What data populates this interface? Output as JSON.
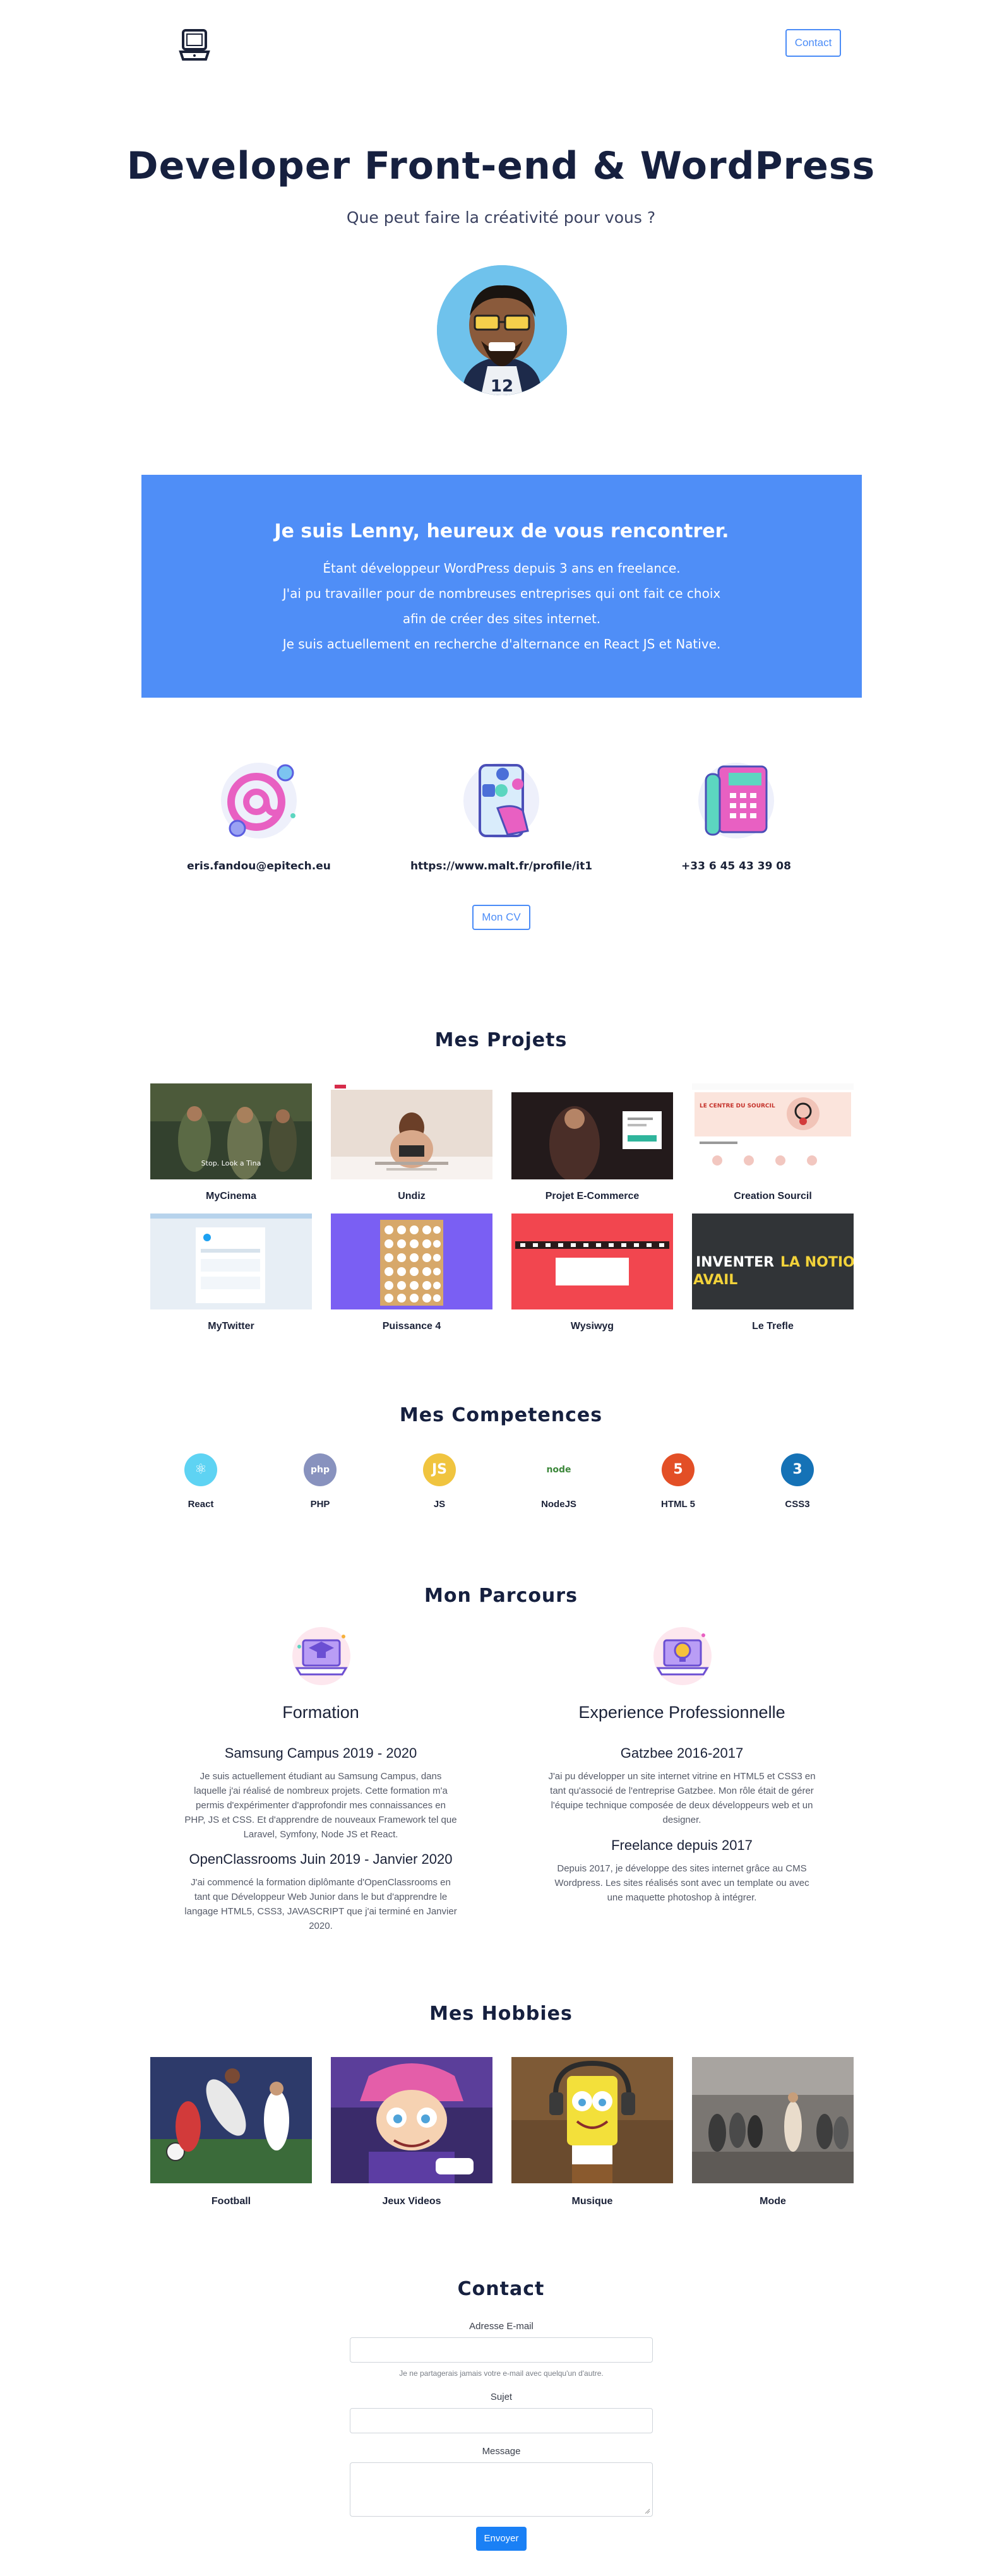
{
  "header": {
    "contact_label": "Contact"
  },
  "hero": {
    "title": "Developer Front-end & WordPress",
    "subtitle": "Que peut faire la créativité pour vous ?"
  },
  "intro": {
    "title": "Je suis Lenny, heureux de vous rencontrer.",
    "lines": [
      "Étant développeur WordPress depuis 3 ans en freelance.",
      "J'ai pu travailler pour de nombreuses entreprises qui ont fait ce choix",
      "afin de créer des sites internet.",
      "Je suis actuellement en recherche d'alternance en React JS et Native."
    ]
  },
  "contact_info": {
    "items": [
      {
        "icon": "email-at-icon",
        "text": "eris.fandou@epitech.eu"
      },
      {
        "icon": "social-phone-icon",
        "text": "https://www.malt.fr/profile/it1"
      },
      {
        "icon": "telephone-icon",
        "text": "+33 6 45 43 39 08"
      }
    ],
    "cv_label": "Mon CV"
  },
  "projects": {
    "title": "Mes Projets",
    "items": [
      {
        "name": "MyCinema"
      },
      {
        "name": "Undiz"
      },
      {
        "name": "Projet E-Commerce"
      },
      {
        "name": "Creation Sourcil"
      },
      {
        "name": "MyTwitter"
      },
      {
        "name": "Puissance 4"
      },
      {
        "name": "Wysiwyg"
      },
      {
        "name": "Le Trefle"
      }
    ],
    "thumb_texts": {
      "mycinema": "Stop. Look a Tina",
      "trefle_1": "INVENTER",
      "trefle_2": "LA NOTION DE",
      "trefle_3": "AVAIL",
      "sourcil": "LE CENTRE DU SOURCIL"
    }
  },
  "skills": {
    "title": "Mes Competences",
    "items": [
      {
        "name": "React",
        "icon": "react-icon",
        "glyph": "⚛",
        "color": "#5ed3f3"
      },
      {
        "name": "PHP",
        "icon": "php-icon",
        "glyph": "php",
        "color": "#8892be"
      },
      {
        "name": "JS",
        "icon": "js-icon",
        "glyph": "JS",
        "color": "#f0c43f"
      },
      {
        "name": "NodeJS",
        "icon": "nodejs-icon",
        "glyph": "node",
        "color": "#ffffff"
      },
      {
        "name": "HTML 5",
        "icon": "html5-icon",
        "glyph": "5",
        "color": "#e34f26"
      },
      {
        "name": "CSS3",
        "icon": "css3-icon",
        "glyph": "3",
        "color": "#1572b6"
      }
    ]
  },
  "parcours": {
    "title": "Mon Parcours",
    "formation": {
      "heading": "Formation",
      "entries": [
        {
          "title": "Samsung Campus 2019 - 2020",
          "lines": [
            "Je suis actuellement étudiant au Samsung Campus, dans",
            "laquelle j'ai réalisé de nombreux projets. Cette formation m'a",
            "permis d'expérimenter d'approfondir mes connaissances en",
            "PHP, JS et CSS. Et d'apprendre de nouveaux Framework tel que",
            "Laravel, Symfony, Node JS et React."
          ]
        },
        {
          "title": "OpenClassrooms Juin 2019 - Janvier 2020",
          "lines": [
            "J'ai commencé la formation diplômante d'OpenClassrooms en",
            "tant que Développeur Web Junior dans le but d'apprendre le",
            "langage HTML5, CSS3, JAVASCRIPT que j'ai  terminé en Janvier",
            "2020."
          ]
        }
      ]
    },
    "experience": {
      "heading": "Experience Professionnelle",
      "entries": [
        {
          "title": "Gatzbee 2016-2017",
          "lines": [
            "J'ai pu développer un site internet vitrine en HTML5 et CSS3 en",
            "tant qu'associé de l'entreprise Gatzbee. Mon rôle était de gérer",
            "l'équipe technique composée de deux développeurs web et un",
            "designer."
          ]
        },
        {
          "title": "Freelance depuis 2017",
          "lines": [
            "Depuis 2017, je développe des sites internet grâce au CMS",
            "Wordpress. Les sites réalisés sont avec un template ou avec",
            "une maquette photoshop à intégrer."
          ]
        }
      ]
    }
  },
  "hobbies": {
    "title": "Mes Hobbies",
    "items": [
      {
        "name": "Football"
      },
      {
        "name": "Jeux Videos"
      },
      {
        "name": "Musique"
      },
      {
        "name": "Mode"
      }
    ]
  },
  "contact_form": {
    "title": "Contact",
    "email_label": "Adresse E-mail",
    "email_help": "Je ne partagerais jamais votre e-mail avec quelqu'un d'autre.",
    "subject_label": "Sujet",
    "message_label": "Message",
    "submit_label": "Envoyer"
  },
  "colors": {
    "accent": "#4f8ef7",
    "heading": "#16203f",
    "button_primary": "#1a80f5"
  }
}
